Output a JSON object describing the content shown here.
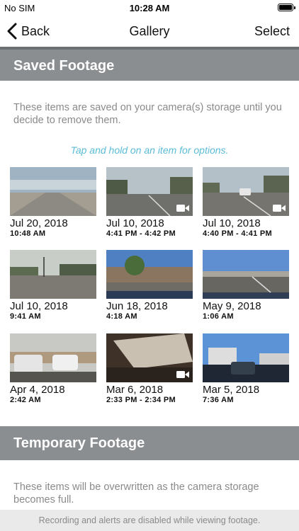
{
  "status_bar": {
    "carrier": "No SIM",
    "time": "10:28 AM"
  },
  "nav": {
    "back_label": "Back",
    "title": "Gallery",
    "select_label": "Select"
  },
  "saved": {
    "title": "Saved Footage",
    "description": "These items are saved on your camera(s) storage until you decide to remove them.",
    "hint": "Tap and hold on an item for options.",
    "items": [
      {
        "date": "Jul 20, 2018",
        "time": "10:48 AM",
        "video": false
      },
      {
        "date": "Jul 10, 2018",
        "time": "4:41 PM - 4:42 PM",
        "video": true
      },
      {
        "date": "Jul 10, 2018",
        "time": "4:40 PM - 4:41 PM",
        "video": true
      },
      {
        "date": "Jul 10, 2018",
        "time": "9:41 AM",
        "video": false
      },
      {
        "date": "Jun 18, 2018",
        "time": "4:18 AM",
        "video": false
      },
      {
        "date": "May 9, 2018",
        "time": "1:06 AM",
        "video": false
      },
      {
        "date": "Apr 4, 2018",
        "time": "2:42 AM",
        "video": false
      },
      {
        "date": "Mar 6, 2018",
        "time": "2:33 PM - 2:34 PM",
        "video": true
      },
      {
        "date": "Mar 5, 2018",
        "time": "7:36 AM",
        "video": false
      }
    ]
  },
  "temporary": {
    "title": "Temporary Footage",
    "description": "These items will be overwritten as the camera storage becomes full."
  },
  "footer": {
    "notice": "Recording and alerts are disabled while viewing footage."
  },
  "colors": {
    "section_header": "#8a8e91",
    "hint": "#5bbcd6",
    "body_text": "#8a8a8a"
  }
}
